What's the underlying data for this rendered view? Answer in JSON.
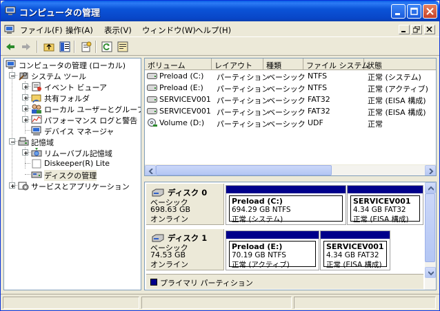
{
  "window": {
    "title": "コンピュータの管理"
  },
  "menu": {
    "items": [
      "ファイル(F)",
      "操作(A)",
      "表示(V)",
      "ウィンドウ(W)",
      "ヘルプ(H)"
    ]
  },
  "tree": {
    "root": "コンピュータの管理 (ローカル)",
    "system_tools": "システム ツール",
    "event_viewer": "イベント ビューア",
    "shared_folders": "共有フォルダ",
    "local_users": "ローカル ユーザーとグループ",
    "performance": "パフォーマンス ログと警告",
    "device_manager": "デバイス マネージャ",
    "storage": "記憶域",
    "removable": "リムーバブル記憶域",
    "diskeeper": "Diskeeper(R) Lite",
    "disk_management": "ディスクの管理",
    "services": "サービスとアプリケーション"
  },
  "volumes": {
    "headers": [
      "ボリューム",
      "レイアウト",
      "種類",
      "ファイル システム",
      "状態"
    ],
    "rows": [
      {
        "volume": "Preload (C:)",
        "layout": "パーティション",
        "type": "ベーシック",
        "fs": "NTFS",
        "status": "正常 (システム)"
      },
      {
        "volume": "Preload (E:)",
        "layout": "パーティション",
        "type": "ベーシック",
        "fs": "NTFS",
        "status": "正常 (アクティブ)"
      },
      {
        "volume": "SERVICEV001",
        "layout": "パーティション",
        "type": "ベーシック",
        "fs": "FAT32",
        "status": "正常 (EISA 構成)"
      },
      {
        "volume": "SERVICEV001",
        "layout": "パーティション",
        "type": "ベーシック",
        "fs": "FAT32",
        "status": "正常 (EISA 構成)"
      },
      {
        "volume": "Volume (D:)",
        "layout": "パーティション",
        "type": "ベーシック",
        "fs": "UDF",
        "status": "正常"
      }
    ]
  },
  "disks": [
    {
      "name": "ディスク 0",
      "kind": "ベーシック",
      "size": "698.63 GB",
      "state": "オンライン",
      "partitions": [
        {
          "name": "Preload  (C:)",
          "size": "694.29 GB NTFS",
          "status": "正常 (システム)"
        },
        {
          "name": "SERVICEV001",
          "size": "4.34 GB FAT32",
          "status": "正常 (EISA 構成)"
        }
      ]
    },
    {
      "name": "ディスク 1",
      "kind": "ベーシック",
      "size": "74.53 GB",
      "state": "オンライン",
      "partitions": [
        {
          "name": "Preload  (E:)",
          "size": "70.19 GB NTFS",
          "status": "正常 (アクティブ)"
        },
        {
          "name": "SERVICEV001",
          "size": "4.34 GB FAT32",
          "status": "正常 (EISA 構成)"
        }
      ]
    }
  ],
  "legend": {
    "primary": "プライマリ パーティション"
  },
  "colors": {
    "partition_bar": "#00008B",
    "title_bar": "#0A5FE6"
  }
}
